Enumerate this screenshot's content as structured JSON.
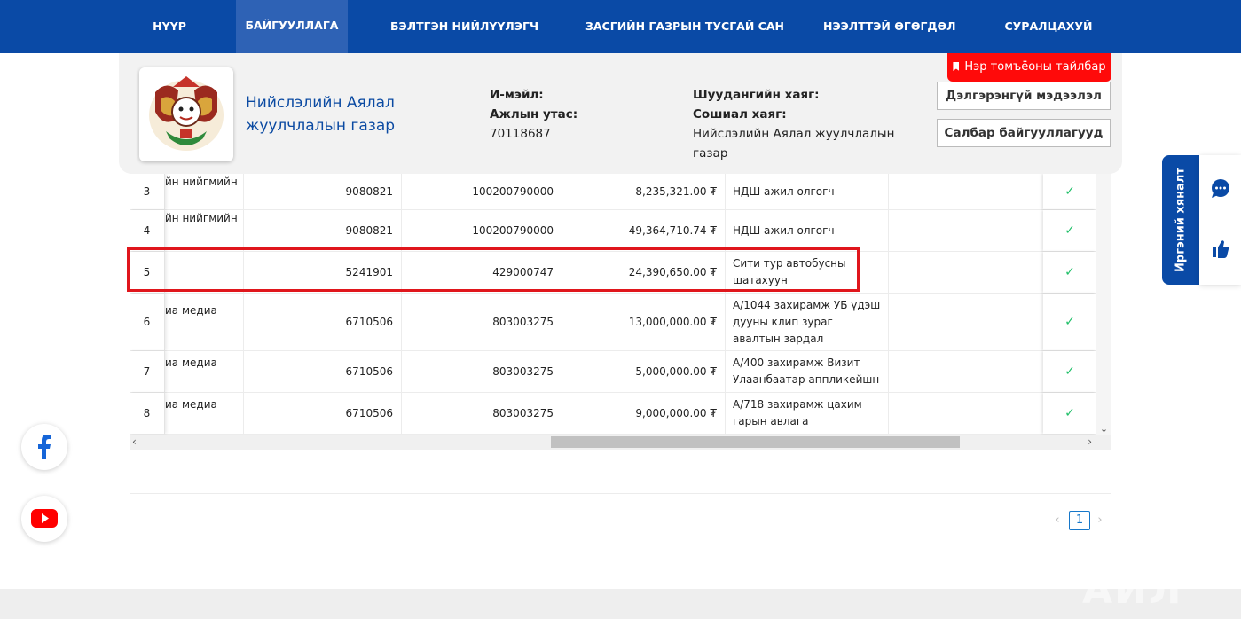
{
  "nav": {
    "items": [
      "НҮҮР",
      "БАЙГУУЛЛАГА",
      "БЭЛТГЭН НИЙЛҮҮЛЭГЧ",
      "ЗАСГИЙН ГАЗРЫН ТУСГАЙ САН",
      "НЭЭЛТТЭЙ ӨГӨГДӨЛ",
      "СУРАЛЦАХУЙ"
    ],
    "active": "БАЙГУУЛЛАГА"
  },
  "org": {
    "name": "Нийслэлийн Аялал жуулчлалын газар",
    "email_label": "И-мэйл:",
    "email_value": "",
    "phone_label": "Ажлын утас:",
    "phone_value": "70118687",
    "address_label": "Шуудангийн хаяг:",
    "address_value": "",
    "social_label": "Сошиал хаяг:",
    "social_value": "Нийслэлийн Аялал жуулчлалын газар",
    "legend_button": "Нэр томъёоны тайлбар",
    "details_button": "Дэлгэрэнгүй мэдээлэл",
    "branches_button": "Салбар байгууллагууд"
  },
  "table": {
    "rows": [
      {
        "no": "3",
        "org": "йн нийгмийн",
        "reg": "9080821",
        "acc": "100200790000",
        "amount": "8,235,321.00 ₮",
        "desc": "НДШ ажил олгогч",
        "status": "✓"
      },
      {
        "no": "4",
        "org": "йн нийгмийн",
        "reg": "9080821",
        "acc": "100200790000",
        "amount": "49,364,710.74 ₮",
        "desc": "НДШ ажил олгогч",
        "status": "✓"
      },
      {
        "no": "5",
        "org": "",
        "reg": "5241901",
        "acc": "429000747",
        "amount": "24,390,650.00 ₮",
        "desc": "Сити тур автобусны шатахуун",
        "status": "✓"
      },
      {
        "no": "6",
        "org": "иа медиа",
        "reg": "6710506",
        "acc": "803003275",
        "amount": "13,000,000.00 ₮",
        "desc": "А/1044 захирамж УБ үдэш дууны клип зураг авалтын зардал",
        "status": "✓"
      },
      {
        "no": "7",
        "org": "иа медиа",
        "reg": "6710506",
        "acc": "803003275",
        "amount": "5,000,000.00 ₮",
        "desc": "А/400 захирамж Визит Улаанбаатар аппликейшн",
        "status": "✓"
      },
      {
        "no": "8",
        "org": "иа медиа",
        "reg": "6710506",
        "acc": "803003275",
        "amount": "9,000,000.00 ₮",
        "desc": "А/718 захирамж цахим гарын авлага",
        "status": "✓"
      }
    ]
  },
  "pagination": {
    "prev": "‹",
    "current": "1",
    "next": "›"
  },
  "feedback": {
    "label": "Иргэний хяналт"
  },
  "social": {
    "facebook": "facebook-icon",
    "youtube": "youtube-icon"
  },
  "watermark": "АЙЛ"
}
